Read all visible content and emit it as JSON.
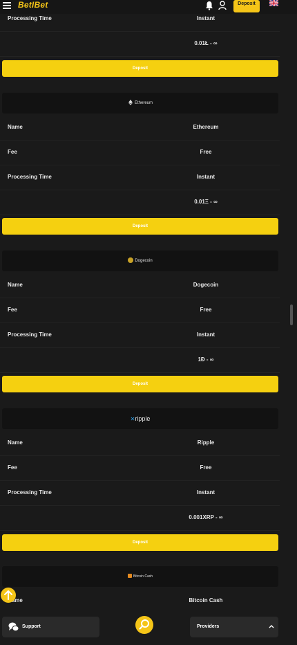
{
  "header": {
    "logo": "BetIBet",
    "deposit_label": "Deposit"
  },
  "sections": [
    {
      "rows": [
        {
          "label": "Processing Time",
          "value": "Instant"
        },
        {
          "label": "",
          "value": "0.01Ł - ∞"
        }
      ],
      "deposit_label": "Deposit"
    },
    {
      "coin_name": "Ethereum",
      "rows": [
        {
          "label": "Name",
          "value": "Ethereum"
        },
        {
          "label": "Fee",
          "value": "Free"
        },
        {
          "label": "Processing Time",
          "value": "Instant"
        },
        {
          "label": "",
          "value": "0.01Ξ - ∞"
        }
      ],
      "deposit_label": "Deposit"
    },
    {
      "coin_name": "Dogecoin",
      "rows": [
        {
          "label": "Name",
          "value": "Dogecoin"
        },
        {
          "label": "Fee",
          "value": "Free"
        },
        {
          "label": "Processing Time",
          "value": "Instant"
        },
        {
          "label": "",
          "value": "1Đ - ∞"
        }
      ],
      "deposit_label": "Deposit"
    },
    {
      "coin_name": "ripple",
      "rows": [
        {
          "label": "Name",
          "value": "Ripple"
        },
        {
          "label": "Fee",
          "value": "Free"
        },
        {
          "label": "Processing Time",
          "value": "Instant"
        },
        {
          "label": "",
          "value": "0.001XRP - ∞"
        }
      ],
      "deposit_label": "Deposit"
    },
    {
      "coin_name": "Bitcoin Cash",
      "rows": [
        {
          "label": "Name",
          "value": "Bitcoin Cash"
        }
      ]
    }
  ],
  "bottom_bar": {
    "support_label": "Support",
    "providers_label": "Providers"
  },
  "colors": {
    "accent": "#f5c518",
    "background": "#1a1a1a"
  }
}
